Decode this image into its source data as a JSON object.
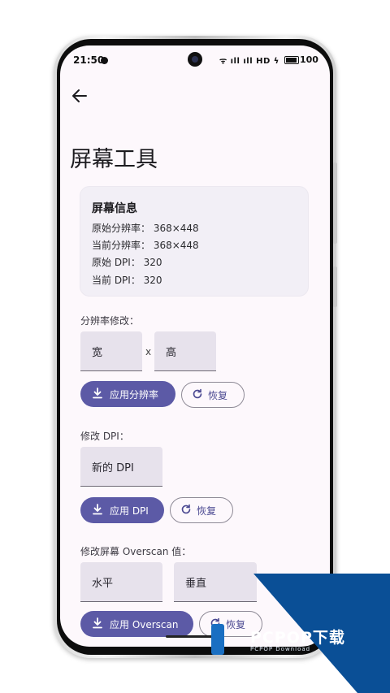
{
  "status_bar": {
    "time": "21:50",
    "signal_text": "ᯤ ıll ıll HD ϟ",
    "battery": "100"
  },
  "page": {
    "title": "屏幕工具",
    "back_icon": "arrow-left-icon"
  },
  "screen_info": {
    "title": "屏幕信息",
    "lines": [
      "原始分辨率： 368×448",
      "当前分辨率： 368×448",
      "原始 DPI： 320",
      "当前 DPI： 320"
    ]
  },
  "resolution": {
    "label": "分辨率修改：",
    "width_placeholder": "宽",
    "separator": "x",
    "height_placeholder": "高",
    "apply_label": "应用分辨率",
    "reset_label": "恢复"
  },
  "dpi": {
    "label": "修改 DPI：",
    "placeholder": "新的 DPI",
    "apply_label": "应用 DPI",
    "reset_label": "恢复"
  },
  "overscan": {
    "label": "修改屏幕 Overscan 值：",
    "horizontal_placeholder": "水平",
    "vertical_placeholder": "垂直",
    "apply_label": "应用 Overscan",
    "reset_label": "恢复"
  },
  "watermark": {
    "text": "PCPOP下载",
    "subtext": "PCPOP Download"
  },
  "colors": {
    "primary": "#5c5aa6",
    "background": "#fdf8fc",
    "card": "#f2eff6",
    "field": "#e7e2ec",
    "watermark": "#0a4f96"
  }
}
